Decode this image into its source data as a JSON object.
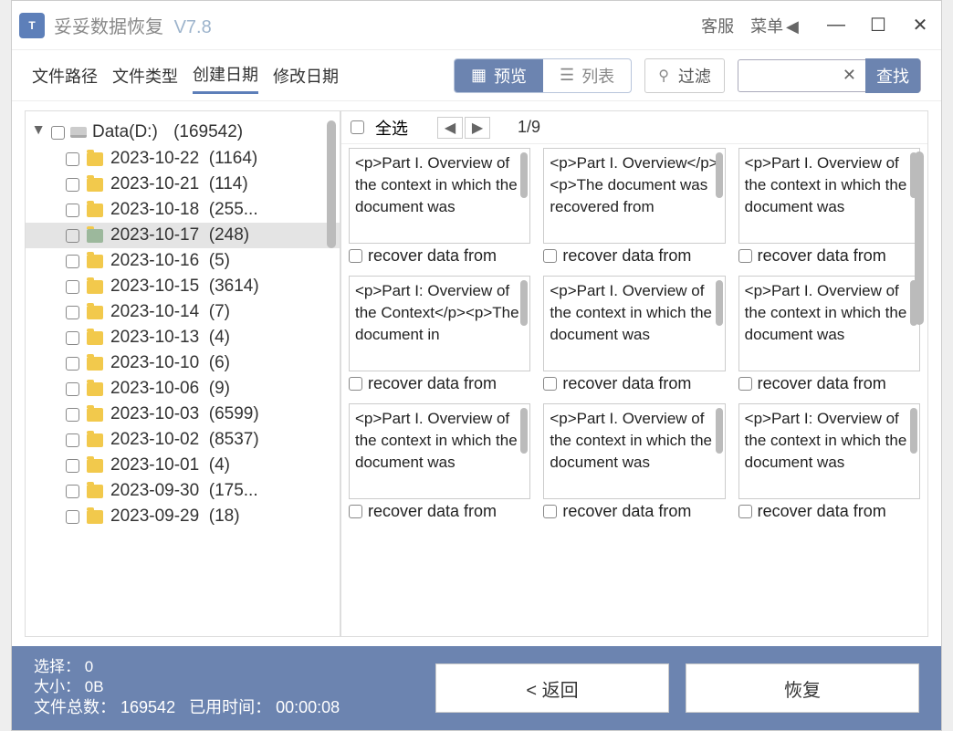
{
  "app": {
    "title": "妥妥数据恢复",
    "version": "V7.8",
    "logo": "T"
  },
  "titlebar": {
    "service": "客服",
    "menu": "菜单"
  },
  "tabs": [
    "文件路径",
    "文件类型",
    "创建日期",
    "修改日期"
  ],
  "active_tab": 2,
  "view": {
    "preview": "预览",
    "list": "列表"
  },
  "filter": "过滤",
  "search_btn": "查找",
  "tree": {
    "drive": "Data(D:)",
    "drive_count": "(169542)",
    "nodes": [
      {
        "name": "2023-10-22",
        "count": "(1164)"
      },
      {
        "name": "2023-10-21",
        "count": "(114)"
      },
      {
        "name": "2023-10-18",
        "count": "(255..."
      },
      {
        "name": "2023-10-17",
        "count": "(248)",
        "sel": true
      },
      {
        "name": "2023-10-16",
        "count": "(5)"
      },
      {
        "name": "2023-10-15",
        "count": "(3614)"
      },
      {
        "name": "2023-10-14",
        "count": "(7)"
      },
      {
        "name": "2023-10-13",
        "count": "(4)"
      },
      {
        "name": "2023-10-10",
        "count": "(6)"
      },
      {
        "name": "2023-10-06",
        "count": "(9)"
      },
      {
        "name": "2023-10-03",
        "count": "(6599)"
      },
      {
        "name": "2023-10-02",
        "count": "(8537)"
      },
      {
        "name": "2023-10-01",
        "count": "(4)"
      },
      {
        "name": "2023-09-30",
        "count": "(175..."
      },
      {
        "name": "2023-09-29",
        "count": "(18)"
      }
    ]
  },
  "mhead": {
    "selectall": "全选",
    "page": "1/9"
  },
  "cards": [
    {
      "text": "<p>Part I. Overview of the context in which the document was",
      "name": "recover data from"
    },
    {
      "text": "<p>Part I. Overview</p><p>The document was recovered from",
      "name": "recover data from"
    },
    {
      "text": "<p>Part I. Overview of the context in which the document was",
      "name": "recover data from"
    },
    {
      "text": "<p>Part I: Overview of the Context</p><p>The document in",
      "name": "recover data from"
    },
    {
      "text": "<p>Part I. Overview of the context in which the document was",
      "name": "recover data from"
    },
    {
      "text": "<p>Part I. Overview of the context in which the document was",
      "name": "recover data from"
    },
    {
      "text": "<p>Part I. Overview of the context in which the document was",
      "name": "recover data from"
    },
    {
      "text": "<p>Part I. Overview of the context in which the document was",
      "name": "recover data from"
    },
    {
      "text": "<p>Part I: Overview of the context in which the document was",
      "name": "recover data from"
    }
  ],
  "footer": {
    "sel_label": "选择：",
    "sel_val": "0",
    "size_label": "大小：",
    "size_val": "0B",
    "total_label": "文件总数：",
    "total_val": "169542",
    "time_label": "已用时间：",
    "time_val": "00:00:08",
    "back": "< 返回",
    "recover": "恢复"
  }
}
